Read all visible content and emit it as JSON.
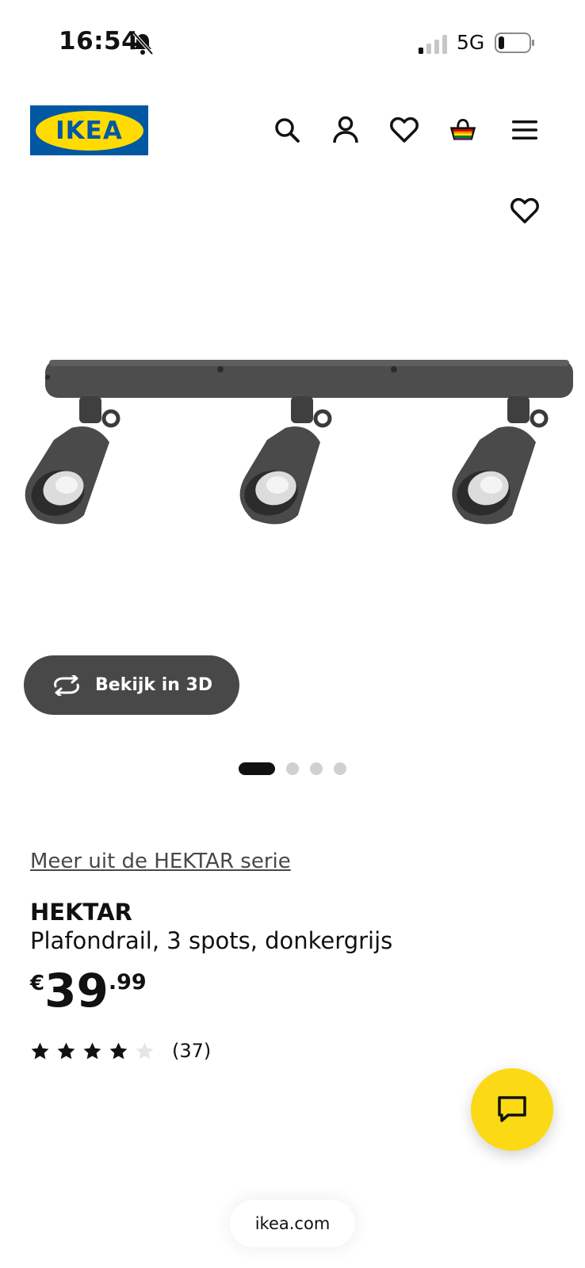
{
  "status_bar": {
    "time": "16:54",
    "network": "5G",
    "icons": [
      "bell-slash-icon",
      "signal-icon",
      "battery-icon"
    ]
  },
  "header": {
    "logo_text": "IKEA",
    "logo_colors": {
      "blue": "#0058a3",
      "yellow": "#ffdb00"
    },
    "icons": [
      "search-icon",
      "account-icon",
      "heart-icon",
      "cart-icon",
      "menu-icon"
    ]
  },
  "product": {
    "image_alt_icon": "ceiling-track-spotlights",
    "view_3d_label": "Bekijk in 3D",
    "carousel": {
      "total": 4,
      "active": 1
    },
    "series_link": "Meer uit de HEKTAR serie",
    "name": "HEKTAR",
    "description": "Plafondrail, 3 spots, donkergrijs",
    "price": {
      "currency": "€",
      "integer": "39",
      "decimal": ".99"
    },
    "rating": {
      "stars": 4,
      "max": 5,
      "count_label": "(37)"
    }
  },
  "chat": {
    "icon": "chat-icon",
    "color": "#fbd914"
  },
  "browser": {
    "url": "ikea.com"
  }
}
